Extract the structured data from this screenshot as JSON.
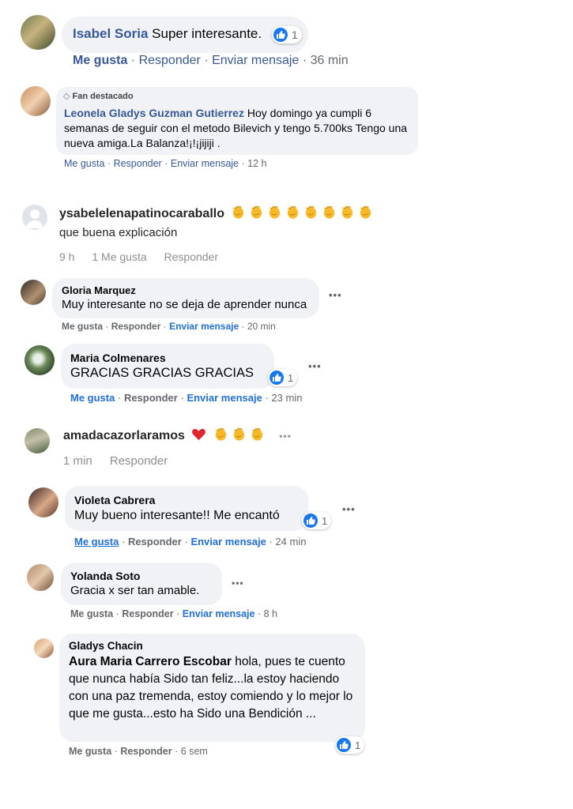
{
  "comments": [
    {
      "name": "Isabel Soria",
      "text": "Super interesante.",
      "reaction_count": "1",
      "actions": {
        "like": "Me gusta",
        "reply": "Responder",
        "message": "Enviar mensaje",
        "time": "36 min"
      }
    },
    {
      "badge": "Fan destacado",
      "name": "Leonela Gladys Guzman Gutierrez",
      "text": "Hoy domingo ya cumpli 6 semanas de seguir con el metodo Bilevich y tengo 5.700ks Tengo una nueva amiga.La Balanza!¡!¡jijiji .",
      "actions": {
        "like": "Me gusta",
        "reply": "Responder",
        "message": "Enviar mensaje",
        "time": "12 h"
      }
    },
    {
      "name": "ysabelelenapatinocaraballo",
      "text": "que buena explicación",
      "emoji_count": 8,
      "actions": {
        "time": "9 h",
        "likes": "1 Me gusta",
        "reply": "Responder"
      }
    },
    {
      "name": "Gloria Marquez",
      "text": "Muy interesante no se deja de aprender nunca",
      "actions": {
        "like": "Me gusta",
        "reply": "Responder",
        "message": "Enviar mensaje",
        "time": "20 min"
      }
    },
    {
      "name": "Maria Colmenares",
      "text": "GRACIAS GRACIAS GRACIAS",
      "reaction_count": "1",
      "actions": {
        "like": "Me gusta",
        "reply": "Responder",
        "message": "Enviar mensaje",
        "time": "23 min"
      }
    },
    {
      "name": "amadacazorlaramos",
      "actions": {
        "time": "1 min",
        "reply": "Responder"
      }
    },
    {
      "name": "Violeta Cabrera",
      "text": "Muy bueno interesante!! Me encantó",
      "reaction_count": "1",
      "actions": {
        "like": "Me gusta",
        "reply": "Responder",
        "message": "Enviar mensaje",
        "time": "24 min"
      }
    },
    {
      "name": "Yolanda Soto",
      "text": "Gracia x ser tan amable.",
      "actions": {
        "like": "Me gusta",
        "reply": "Responder",
        "message": "Enviar mensaje",
        "time": "8 h"
      }
    },
    {
      "name": "Gladys Chacin",
      "mention": "Aura Maria Carrero Escobar",
      "text": " hola, pues te cuento que nunca había Sido tan feliz...la estoy haciendo con una paz tremenda, estoy comiendo y lo mejor lo que me gusta...esto ha Sido una Bendición ...",
      "reaction_count": "1",
      "actions": {
        "like": "Me gusta",
        "reply": "Responder",
        "time": "6 sem"
      }
    }
  ],
  "separator": "·",
  "colors": {
    "facebook_blue": "#385898",
    "like_blue": "#1877f2",
    "link_blue": "#216fdb",
    "gray": "#65676b",
    "bubble": "#f0f2f5"
  }
}
